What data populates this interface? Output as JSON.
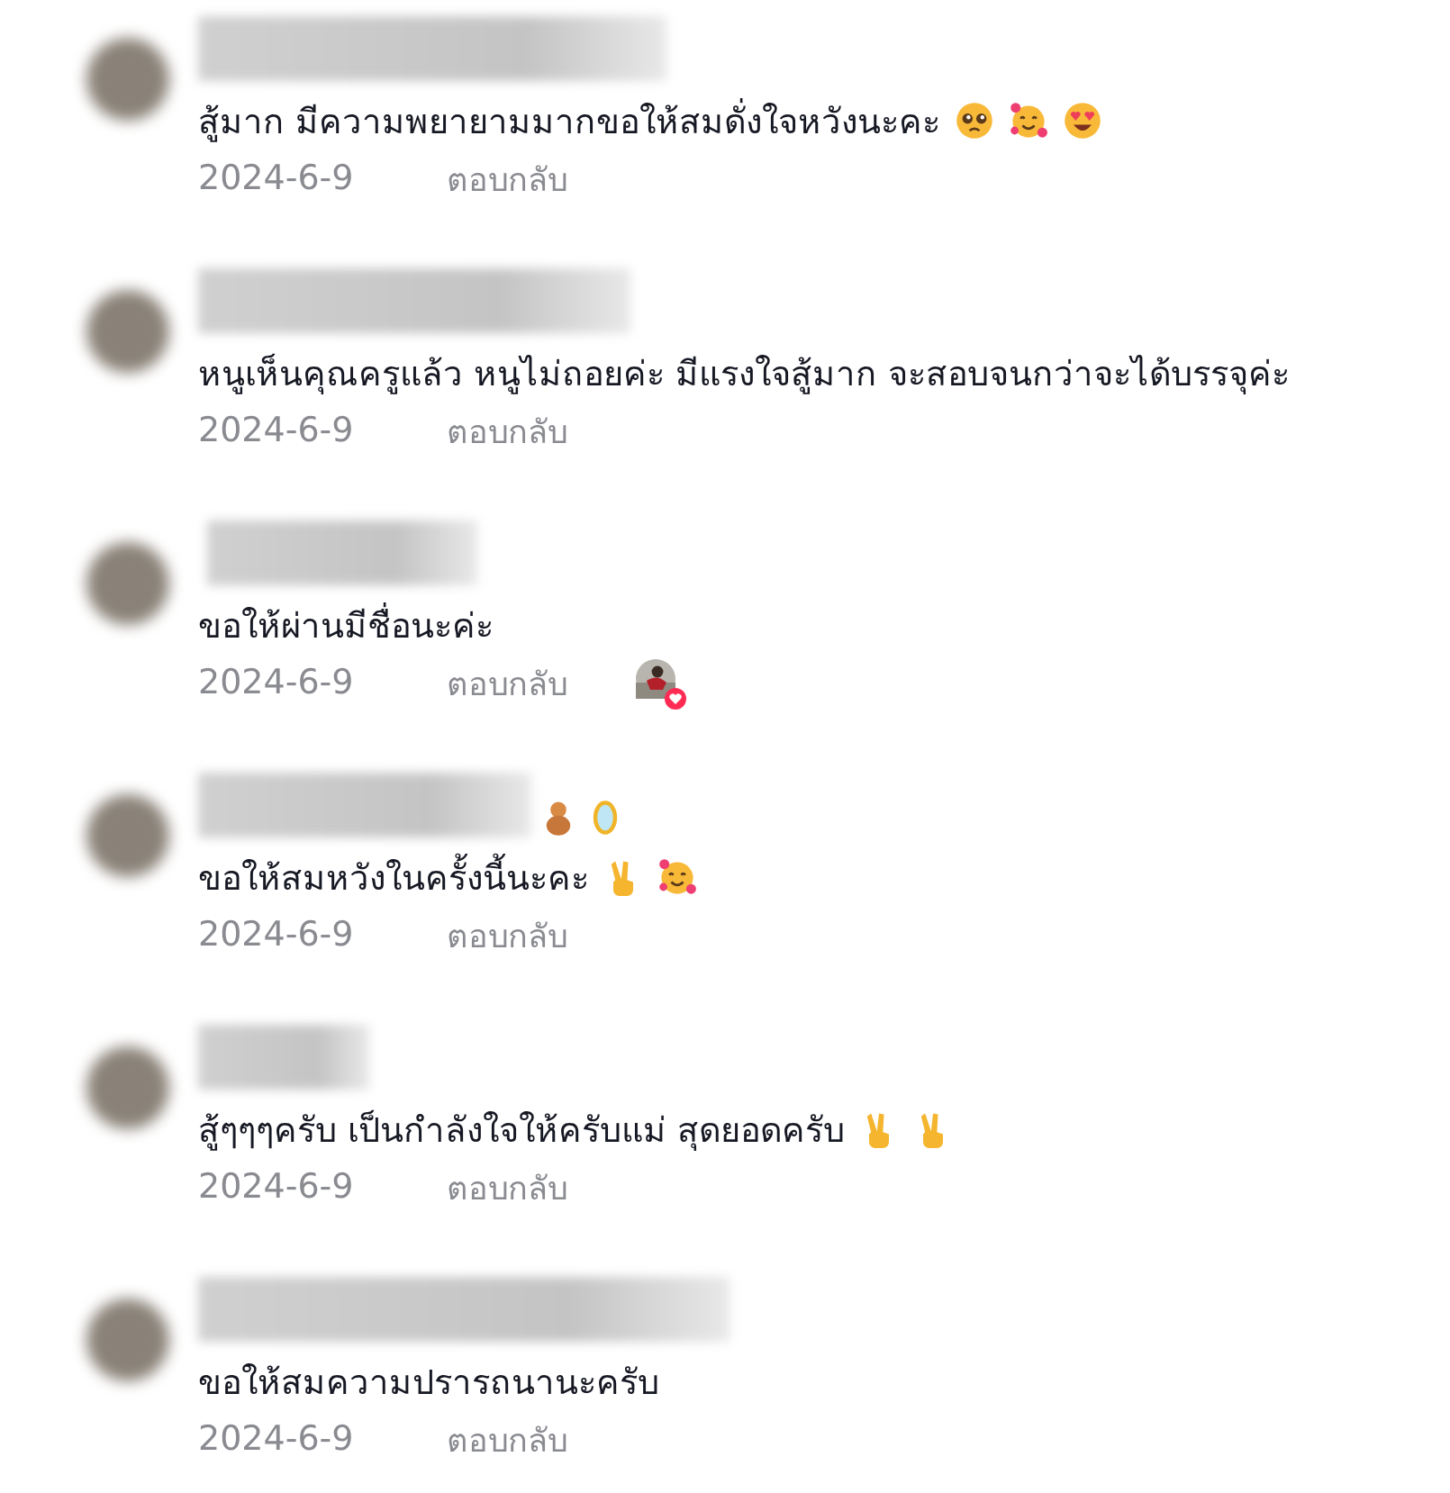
{
  "comments": [
    {
      "text": "สู้มาก มีความพยายามมากขอให้สมดั่งใจหวังนะคะ",
      "emojis": [
        {
          "kind": "pleading"
        },
        {
          "kind": "hearts"
        },
        {
          "kind": "heart-eyes"
        }
      ],
      "date": "2024-6-9",
      "reply": "ตอบกลับ",
      "liked_by_creator": false
    },
    {
      "text": "หนูเห็นคุณครูแล้ว หนูไม่ถอยค่ะ มีแรงใจสู้มาก จะสอบจนกว่าจะได้บรรจุค่ะ",
      "date": "2024-6-9",
      "reply": "ตอบกลับ",
      "liked_by_creator": false
    },
    {
      "text": "ขอให้ผ่านมีชื่อนะค่ะ",
      "date": "2024-6-9",
      "reply": "ตอบกลับ",
      "liked_by_creator": true
    },
    {
      "name_emojis": [
        {
          "kind": "bear"
        },
        {
          "kind": "mirror"
        }
      ],
      "text": "ขอให้สมหวังในครั้งนี้นะคะ",
      "emojis": [
        {
          "kind": "victory"
        },
        {
          "kind": "hearts"
        }
      ],
      "date": "2024-6-9",
      "reply": "ตอบกลับ",
      "liked_by_creator": false
    },
    {
      "text": "สู้ๆๆๆครับ เป็นกำลังใจให้ครับแม่ สุดยอดครับ",
      "emojis": [
        {
          "kind": "victory"
        },
        {
          "kind": "victory"
        }
      ],
      "date": "2024-6-9",
      "reply": "ตอบกลับ",
      "liked_by_creator": false
    },
    {
      "text": "ขอให้สมความปรารถนานะครับ",
      "date": "2024-6-9",
      "reply": "ตอบกลับ",
      "liked_by_creator": false
    }
  ]
}
